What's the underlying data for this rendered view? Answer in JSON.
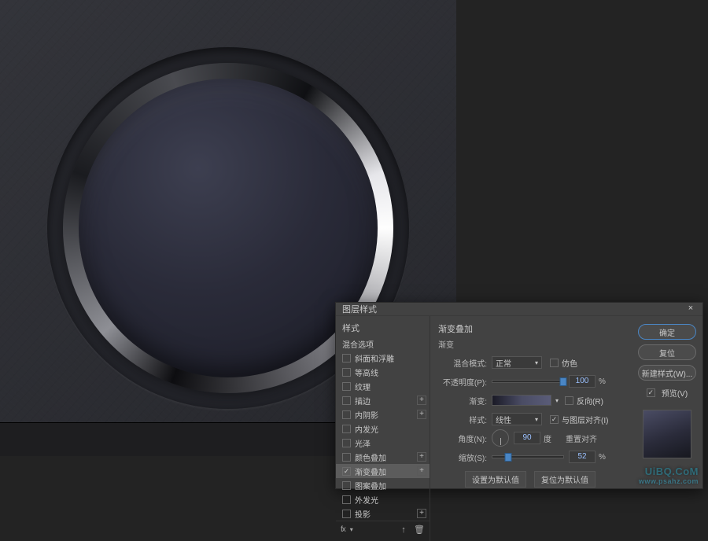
{
  "dialog": {
    "title": "图层样式",
    "sections": {
      "styles_header": "样式",
      "blend_options": "混合选项",
      "items": [
        {
          "label": "斜面和浮雕",
          "checked": false,
          "plus": false
        },
        {
          "label": "等高线",
          "checked": false,
          "plus": false
        },
        {
          "label": "纹理",
          "checked": false,
          "plus": false
        },
        {
          "label": "描边",
          "checked": false,
          "plus": true
        },
        {
          "label": "内阴影",
          "checked": false,
          "plus": true
        },
        {
          "label": "内发光",
          "checked": false,
          "plus": false
        },
        {
          "label": "光泽",
          "checked": false,
          "plus": false
        },
        {
          "label": "颜色叠加",
          "checked": false,
          "plus": true
        },
        {
          "label": "渐变叠加",
          "checked": true,
          "selected": true,
          "plus": true
        },
        {
          "label": "图案叠加",
          "checked": false,
          "plus": false
        },
        {
          "label": "外发光",
          "checked": false,
          "plus": false
        },
        {
          "label": "投影",
          "checked": false,
          "plus": true
        }
      ]
    },
    "footer": {
      "fx": "fx"
    },
    "params": {
      "section_title": "渐变叠加",
      "subsection": "渐变",
      "blend_mode_lbl": "混合模式:",
      "blend_mode_val": "正常",
      "dither_lbl": "仿色",
      "dither_checked": false,
      "opacity_lbl": "不透明度(P):",
      "opacity_val": "100",
      "opacity_unit": "%",
      "gradient_lbl": "渐变:",
      "reverse_lbl": "反向(R)",
      "reverse_checked": false,
      "style_lbl": "样式:",
      "style_val": "线性",
      "align_lbl": "与图层对齐(I)",
      "align_checked": true,
      "angle_lbl": "角度(N):",
      "angle_val": "90",
      "angle_unit": "度",
      "reset_align": "重置对齐",
      "scale_lbl": "缩放(S):",
      "scale_val": "52",
      "scale_unit": "%",
      "make_default": "设置为默认值",
      "reset_default": "复位为默认值"
    },
    "buttons": {
      "ok": "确定",
      "cancel": "复位",
      "new_style": "新建样式(W)...",
      "preview_lbl": "预览(V)",
      "preview_checked": true
    }
  },
  "watermark": {
    "main": "UiBQ.CoM",
    "sub": "www.psahz.com"
  }
}
